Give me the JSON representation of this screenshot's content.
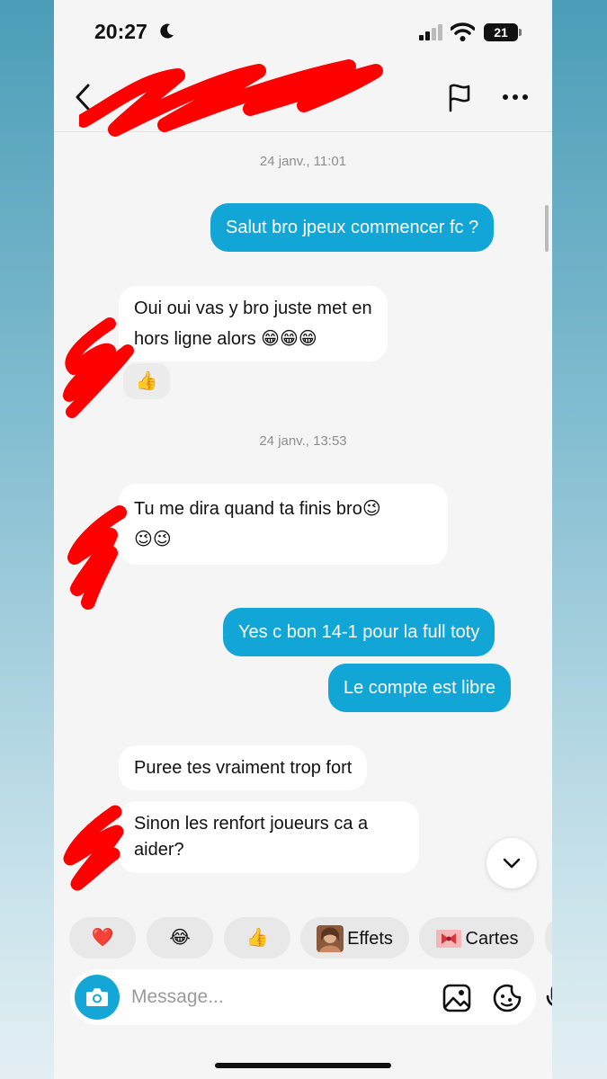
{
  "status_bar": {
    "time": "20:27",
    "battery": "21"
  },
  "header": {
    "contact_name": ""
  },
  "messages": [
    {
      "type": "timestamp",
      "text": "24 janv., 11:01"
    },
    {
      "type": "sent",
      "text": "Salut bro jpeux commencer fc ?"
    },
    {
      "type": "received",
      "lines": [
        "Oui oui vas y bro juste met en",
        "hors ligne alors 😁😁😁"
      ],
      "reaction": "👍"
    },
    {
      "type": "timestamp",
      "text": "24 janv., 13:53"
    },
    {
      "type": "received",
      "lines": [
        "Tu me dira quand ta finis  bro😉",
        "😉😉"
      ]
    },
    {
      "type": "sent",
      "text": "Yes c bon 14-1 pour la full toty"
    },
    {
      "type": "sent",
      "text": "Le compte est libre"
    },
    {
      "type": "received",
      "lines": [
        "Puree tes vraiment trop fort"
      ]
    },
    {
      "type": "received",
      "lines": [
        "Sinon les renfort joueurs ca a",
        "aider?"
      ]
    }
  ],
  "quick_reactions": [
    {
      "icon": "heart-icon",
      "emoji": "❤️"
    },
    {
      "icon": "laughing-icon",
      "emoji": "😂"
    },
    {
      "icon": "thumbs-up-icon",
      "emoji": "👍"
    },
    {
      "icon": "effects-thumbnail",
      "label": "Effets"
    },
    {
      "icon": "gift-card-icon",
      "label": "Cartes"
    }
  ],
  "input": {
    "placeholder": "Message..."
  },
  "colors": {
    "sent_bubble": "#12a6d7",
    "received_bubble": "#ffffff",
    "background": "#f5f5f5",
    "accent": "#15a6d8"
  }
}
